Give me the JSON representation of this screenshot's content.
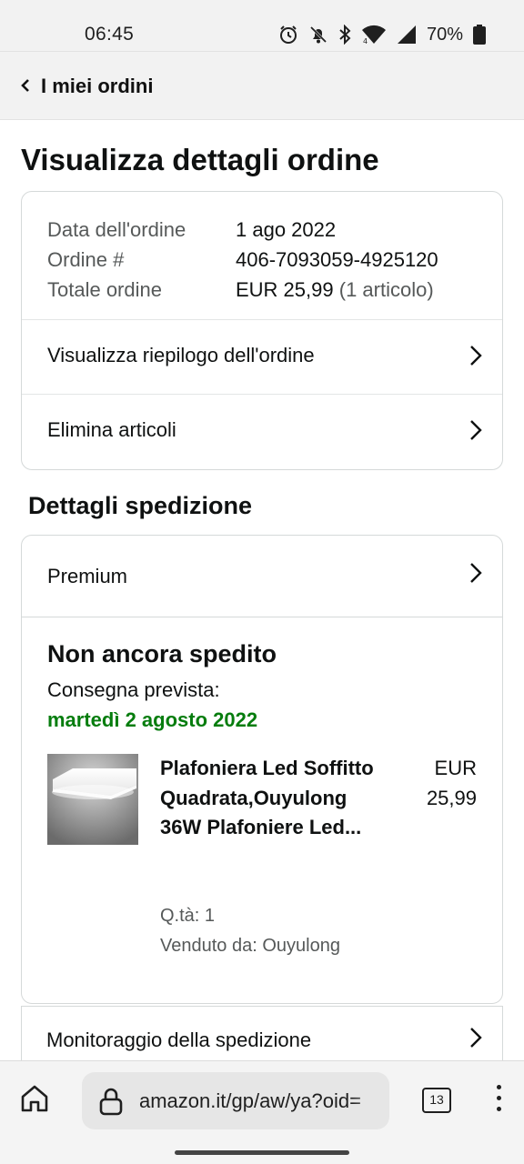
{
  "status_bar": {
    "time": "06:45",
    "battery": "70%",
    "icons": [
      "alarm-icon",
      "bell-off-icon",
      "bluetooth-icon",
      "wifi-icon",
      "signal-icon",
      "battery-icon"
    ]
  },
  "nav": {
    "back_label": "I miei ordini"
  },
  "page": {
    "title": "Visualizza dettagli ordine"
  },
  "order_summary": {
    "date_label": "Data dell'ordine",
    "date_value": "1 ago 2022",
    "order_label": "Ordine #",
    "order_value": "406-7093059-4925120",
    "total_label": "Totale ordine",
    "total_value": "EUR 25,99",
    "total_items": "(1 articolo)",
    "view_summary_label": "Visualizza riepilogo dell'ordine",
    "remove_items_label": "Elimina articoli"
  },
  "shipment": {
    "section_title": "Dettagli spedizione",
    "shipping_type": "Premium",
    "status": "Non ancora spedito",
    "delivery_label": "Consegna prevista:",
    "delivery_date": "martedì 2 agosto 2022",
    "tracking_label": "Monitoraggio della spedizione"
  },
  "product": {
    "title": "Plafoniera Led Soffitto Quadrata,Ouyulong 36W Plafoniere Led...",
    "price_currency": "EUR",
    "price_value": "25,99",
    "quantity": "Q.tà: 1",
    "seller": "Venduto da: Ouyulong"
  },
  "browser": {
    "url": "amazon.it/gp/aw/ya?oid=",
    "tab_count": "13"
  },
  "colors": {
    "accent_green": "#067d0e",
    "text_primary": "#0f1111",
    "text_secondary": "#565959",
    "border": "#d5d9d9",
    "header_bg": "#f2f2f2"
  }
}
